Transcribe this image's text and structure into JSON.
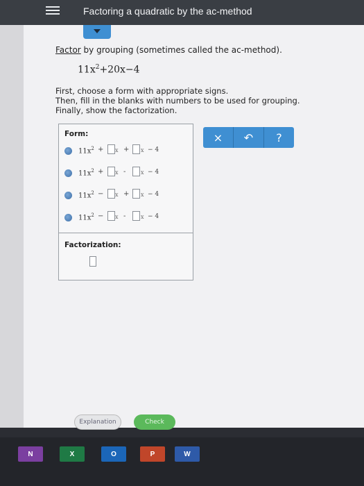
{
  "header": {
    "title": "Factoring a quadratic by the ac-method"
  },
  "problem": {
    "keyword": "Factor",
    "instruction_rest": " by grouping (sometimes called the ac-method).",
    "quad_coef": "11x",
    "quad_exp": "2",
    "quad_rest": "+20x−4",
    "directions": [
      "First, choose a form with appropriate signs.",
      "Then, fill in the blanks with numbers to be used for grouping.",
      "Finally, show the factorization."
    ]
  },
  "form": {
    "title": "Form:",
    "options": [
      {
        "lead": "11x",
        "exp": "2",
        "op1": "+",
        "op2": "+",
        "const": "− 4"
      },
      {
        "lead": "11x",
        "exp": "2",
        "op1": "+",
        "op2": "-",
        "const": "− 4"
      },
      {
        "lead": "11x",
        "exp": "2",
        "op1": "−",
        "op2": "+",
        "const": "− 4"
      },
      {
        "lead": "11x",
        "exp": "2",
        "op1": "−",
        "op2": "-",
        "const": "− 4"
      }
    ],
    "var": "x"
  },
  "factorization": {
    "title": "Factorization:"
  },
  "toolbar": {
    "clear": "×",
    "undo": "↶",
    "help": "?"
  },
  "actions": {
    "explanation": "Explanation",
    "check": "Check"
  },
  "taskbar": [
    {
      "label": "N",
      "color": "#7b3fa0"
    },
    {
      "label": "X",
      "color": "#1f7a45"
    },
    {
      "label": "O",
      "color": "#1b66b8"
    },
    {
      "label": "P",
      "color": "#c0462a"
    },
    {
      "label": "W",
      "color": "#2e5aa8"
    }
  ]
}
